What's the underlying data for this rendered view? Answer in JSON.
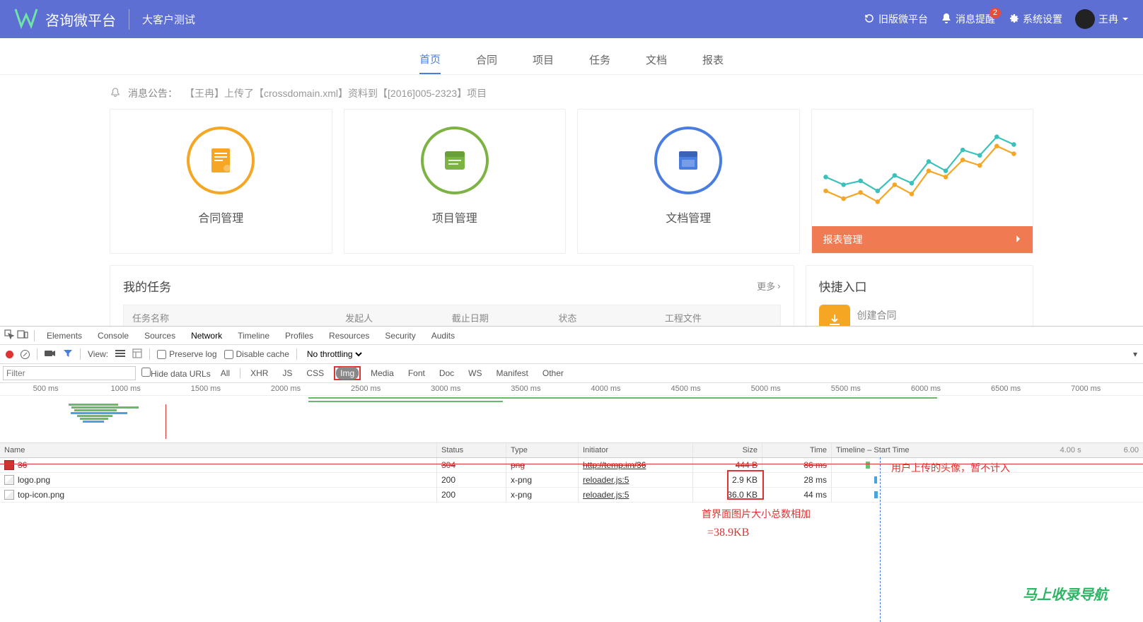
{
  "header": {
    "app_title": "咨询微平台",
    "sub_title": "大客户测试",
    "links": {
      "old_version": "旧版微平台",
      "notifications": "消息提醒",
      "notification_count": "2",
      "settings": "系统设置",
      "user_name": "王冉"
    }
  },
  "nav": {
    "tabs": [
      "首页",
      "合同",
      "项目",
      "任务",
      "文档",
      "报表"
    ],
    "active_index": 0
  },
  "announcement": {
    "prefix": "消息公告：",
    "text": "【王冉】上传了【crossdomain.xml】资料到【[2016]005-2323】项目"
  },
  "cards": {
    "contract": "合同管理",
    "project": "项目管理",
    "document": "文档管理",
    "report_action": "报表管理"
  },
  "tasks_panel": {
    "title": "我的任务",
    "more": "更多",
    "columns": [
      "任务名称",
      "发起人",
      "截止日期",
      "状态",
      "工程文件"
    ]
  },
  "quick_panel": {
    "title": "快捷入口",
    "item1": "创建合同"
  },
  "devtools": {
    "tabs": [
      "Elements",
      "Console",
      "Sources",
      "Network",
      "Timeline",
      "Profiles",
      "Resources",
      "Security",
      "Audits"
    ],
    "active_tab": "Network",
    "toolbar": {
      "view_label": "View:",
      "preserve_log": "Preserve log",
      "disable_cache": "Disable cache",
      "throttling": "No throttling"
    },
    "filter": {
      "placeholder": "Filter",
      "hide_data_urls": "Hide data URLs",
      "tabs": [
        "All",
        "XHR",
        "JS",
        "CSS",
        "Img",
        "Media",
        "Font",
        "Doc",
        "WS",
        "Manifest",
        "Other"
      ],
      "selected": "Img"
    },
    "timeline_ticks": [
      "500 ms",
      "1000 ms",
      "1500 ms",
      "2000 ms",
      "2500 ms",
      "3000 ms",
      "3500 ms",
      "4000 ms",
      "4500 ms",
      "5000 ms",
      "5500 ms",
      "6000 ms",
      "6500 ms",
      "7000 ms"
    ],
    "table": {
      "columns": [
        "Name",
        "Status",
        "Type",
        "Initiator",
        "Size",
        "Time",
        "Timeline – Start Time"
      ],
      "right_label_1": "4.00 s",
      "right_label_2": "6.00",
      "rows": [
        {
          "name": "36",
          "status": "304",
          "type": "png",
          "initiator": "http://temp.im/36",
          "size": "444 B",
          "time": "86 ms",
          "strike": true
        },
        {
          "name": "logo.png",
          "status": "200",
          "type": "x-png",
          "initiator": "reloader.js:5",
          "size": "2.9 KB",
          "time": "28 ms"
        },
        {
          "name": "top-icon.png",
          "status": "200",
          "type": "x-png",
          "initiator": "reloader.js:5",
          "size": "36.0 KB",
          "time": "44 ms"
        }
      ]
    },
    "annotations": {
      "avatar_note": "用户上传的头像，暂不计入",
      "sum_line1": "首界面图片大小总数相加",
      "sum_line2": "=38.9KB"
    }
  },
  "watermark": "马上收录导航",
  "chart_data": {
    "type": "line",
    "title": "",
    "series": [
      {
        "name": "teal",
        "color": "#3bc1bb",
        "values": [
          60,
          45,
          50,
          35,
          55,
          40,
          70,
          55,
          80,
          72,
          90,
          78
        ]
      },
      {
        "name": "orange",
        "color": "#f5a623",
        "values": [
          40,
          25,
          35,
          20,
          45,
          30,
          60,
          50,
          70,
          62,
          82,
          70
        ]
      }
    ],
    "x": [
      1,
      2,
      3,
      4,
      5,
      6,
      7,
      8,
      9,
      10,
      11,
      12
    ],
    "ylim": [
      0,
      100
    ]
  }
}
